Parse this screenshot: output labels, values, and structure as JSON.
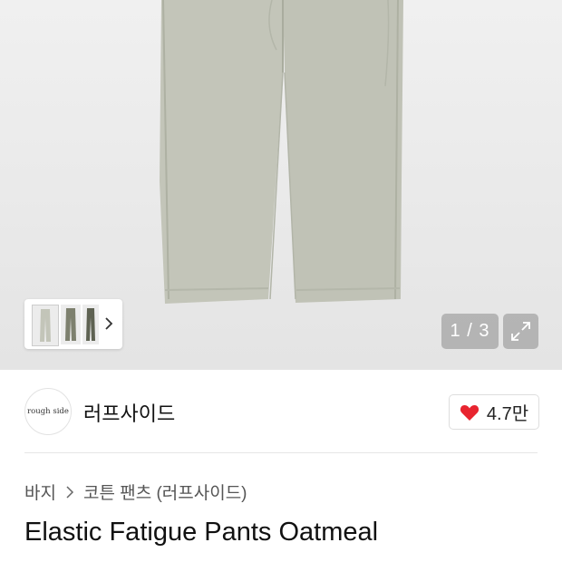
{
  "gallery": {
    "counter": "1 / 3",
    "colors": {
      "pants": "#c3c5b9",
      "pants_shadow": "#aeb1a3"
    }
  },
  "brand": {
    "logo_text": "rough side",
    "name": "러프사이드"
  },
  "like": {
    "count": "4.7만",
    "heart_color": "#e8242f"
  },
  "breadcrumb": {
    "items": [
      "바지",
      "코튼 팬츠 (러프사이드)"
    ]
  },
  "product": {
    "title": "Elastic Fatigue Pants Oatmeal"
  }
}
